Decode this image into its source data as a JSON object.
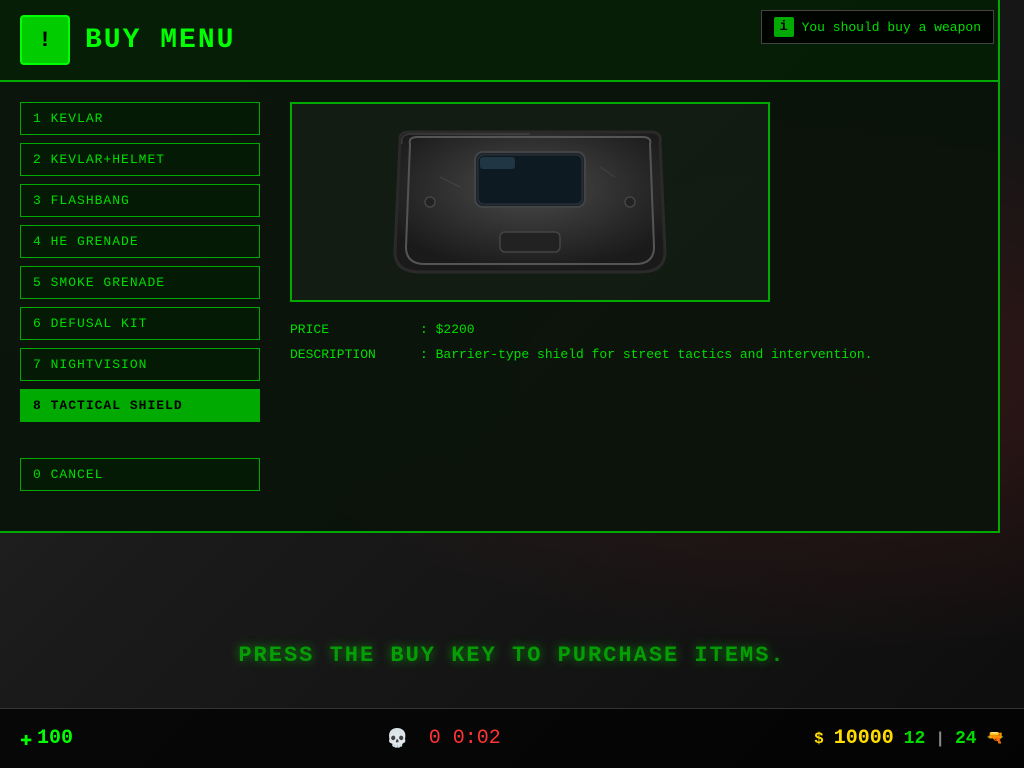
{
  "notification": {
    "icon": "i",
    "text": "You should buy a weapon"
  },
  "header": {
    "icon": "!",
    "title": "Buy menu"
  },
  "menu_items": [
    {
      "key": "1",
      "label": "KEVLAR",
      "selected": false
    },
    {
      "key": "2",
      "label": "KEVLAR+HELMET",
      "selected": false
    },
    {
      "key": "3",
      "label": "FLASHBANG",
      "selected": false
    },
    {
      "key": "4",
      "label": "HE GRENADE",
      "selected": false
    },
    {
      "key": "5",
      "label": "SMOKE GRENADE",
      "selected": false
    },
    {
      "key": "6",
      "label": "DEFUSAL KIT",
      "selected": false
    },
    {
      "key": "7",
      "label": "NIGHTVISION",
      "selected": false
    },
    {
      "key": "8",
      "label": "TACTICAL SHIELD",
      "selected": true
    },
    {
      "key": "0",
      "label": "CANCEL",
      "selected": false
    }
  ],
  "item_detail": {
    "price_label": "PRICE",
    "price_value": ": $2200",
    "description_label": "DESCRIPTION",
    "description_value": ": Barrier-type shield for street tactics and intervention."
  },
  "buy_key_message": "Press the BUY key to purchase items.",
  "hud": {
    "health": "100",
    "money": "$ 10000",
    "timer": "0:02",
    "ammo_mag": "12",
    "ammo_reserve": "24",
    "kills": "0"
  }
}
